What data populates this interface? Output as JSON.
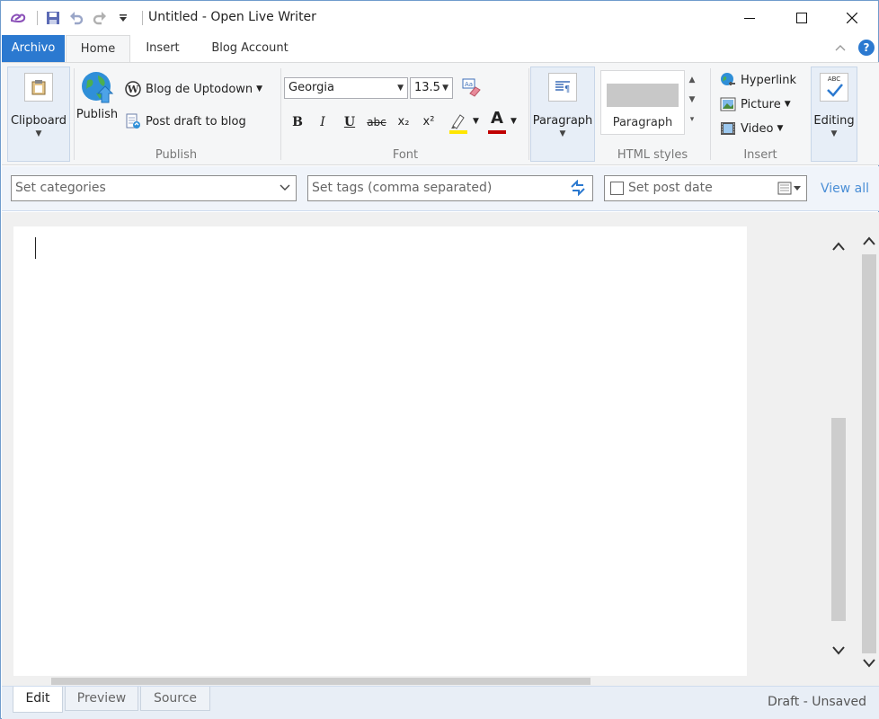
{
  "window": {
    "title": "Untitled - Open Live Writer"
  },
  "tabs": {
    "file": "Archivo",
    "home": "Home",
    "insert": "Insert",
    "blog_account": "Blog Account"
  },
  "help": "?",
  "ribbon": {
    "clipboard": {
      "label": "Clipboard"
    },
    "publish": {
      "publish_label": "Publish",
      "blog_name": "Blog de Uptodown",
      "post_draft": "Post draft to blog",
      "group_label": "Publish"
    },
    "font": {
      "family": "Georgia",
      "size": "13.5",
      "bold": "B",
      "italic": "I",
      "underline": "U",
      "strike": "abc",
      "subscript": "x₂",
      "superscript": "x²",
      "color_letter": "A",
      "group_label": "Font"
    },
    "paragraph": {
      "label": "Paragraph"
    },
    "html_styles": {
      "current": "Paragraph",
      "group_label": "HTML styles"
    },
    "insert": {
      "hyperlink": "Hyperlink",
      "picture": "Picture",
      "video": "Video",
      "group_label": "Insert"
    },
    "editing": {
      "label": "Editing",
      "abc": "ABC"
    }
  },
  "properties": {
    "categories_placeholder": "Set categories",
    "tags_placeholder": "Set tags (comma separated)",
    "post_date_label": "Set post date",
    "view_all": "View all"
  },
  "view_tabs": {
    "edit": "Edit",
    "preview": "Preview",
    "source": "Source"
  },
  "status": "Draft - Unsaved",
  "colors": {
    "accent": "#2b79d0",
    "link": "#4a8ed6",
    "ribbon_bg": "#f5f6f7",
    "highlight_bar": "#ffe600",
    "font_color_bar": "#c00000"
  }
}
